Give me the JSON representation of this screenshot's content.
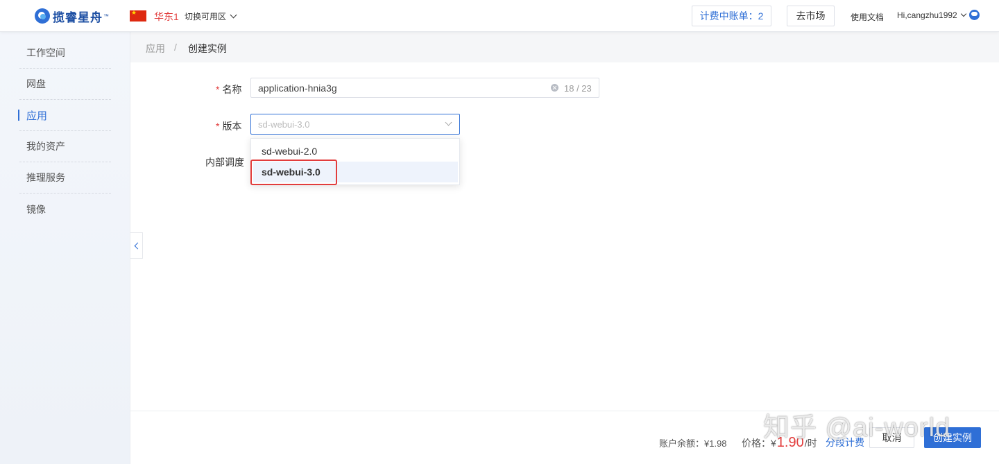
{
  "header": {
    "logo_text": "揽睿星舟",
    "logo_tm": "™",
    "region": "华东1",
    "switch_zone": "切换可用区",
    "billing_label": "计费中账单：2",
    "market_label": "去市场",
    "docs_label": "使用文档",
    "user_label": "Hi,cangzhu1992"
  },
  "sidebar": {
    "items": [
      {
        "label": "工作空间"
      },
      {
        "label": "网盘"
      },
      {
        "label": "应用"
      },
      {
        "label": "我的资产"
      },
      {
        "label": "推理服务"
      },
      {
        "label": "镜像"
      }
    ],
    "active_index": 2
  },
  "breadcrumb": {
    "parent": "应用",
    "separator": "/",
    "current": "创建实例"
  },
  "form": {
    "name_label": "名称",
    "name_value": "application-hnia3g",
    "name_counter": "18 / 23",
    "version_label": "版本",
    "version_placeholder": "sd-webui-3.0",
    "scheduling_label": "内部调度",
    "version_options": [
      "sd-webui-2.0",
      "sd-webui-3.0"
    ],
    "selected_option": "sd-webui-3.0"
  },
  "footer": {
    "balance": "账户余额：¥1.98",
    "price_prefix": "价格：¥",
    "price_value": "1.90",
    "price_unit": "/时",
    "tier_link": "分段计费",
    "cancel_label": "取消",
    "create_label": "创建实例"
  },
  "watermark": "知乎 @ai-world",
  "colors": {
    "accent": "#2f6fd6",
    "danger": "#e23c3c",
    "sidebar_bg": "#f3f6fb"
  }
}
